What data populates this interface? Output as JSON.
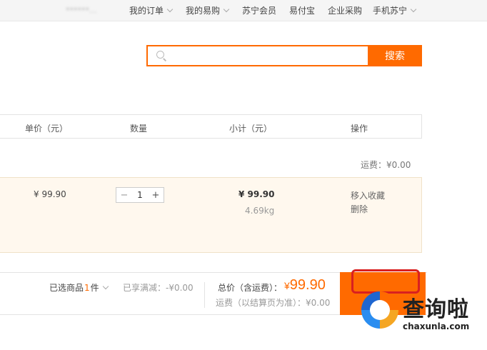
{
  "topnav": {
    "user": "******...",
    "items": [
      {
        "label": "我的订单",
        "dropdown": true
      },
      {
        "label": "我的易购",
        "dropdown": true
      },
      {
        "label": "苏宁会员",
        "dropdown": false
      },
      {
        "label": "易付宝",
        "dropdown": false
      },
      {
        "label": "企业采购",
        "dropdown": false
      },
      {
        "label": "手机苏宁",
        "dropdown": true
      }
    ]
  },
  "search": {
    "placeholder": "",
    "value": "",
    "button_label": "搜索"
  },
  "table": {
    "headers": {
      "unit_price": "单价（元）",
      "quantity": "数量",
      "subtotal": "小计（元）",
      "actions": "操作"
    },
    "shipping_fee": "运费：¥0.00",
    "item": {
      "unit_price": "¥ 99.90",
      "quantity": "1",
      "subtotal": "¥ 99.90",
      "weight": "4.69kg",
      "action_favorite": "移入收藏",
      "action_delete": "删除"
    }
  },
  "footer": {
    "selected_prefix": "已选商品",
    "selected_count": "1",
    "selected_unit": "件",
    "discount": "已享满减：-¥0.00",
    "total_label": "总价（含运费）：",
    "total_currency": "¥",
    "total_value": "99.90",
    "shipping_note": "运费（以结算页为准）：¥0.00"
  },
  "watermark": {
    "title": "查询啦",
    "url": "chaxunla.com"
  },
  "colors": {
    "accent": "#ff6a00",
    "highlight": "#d92020",
    "row_bg": "#fff8ee"
  }
}
